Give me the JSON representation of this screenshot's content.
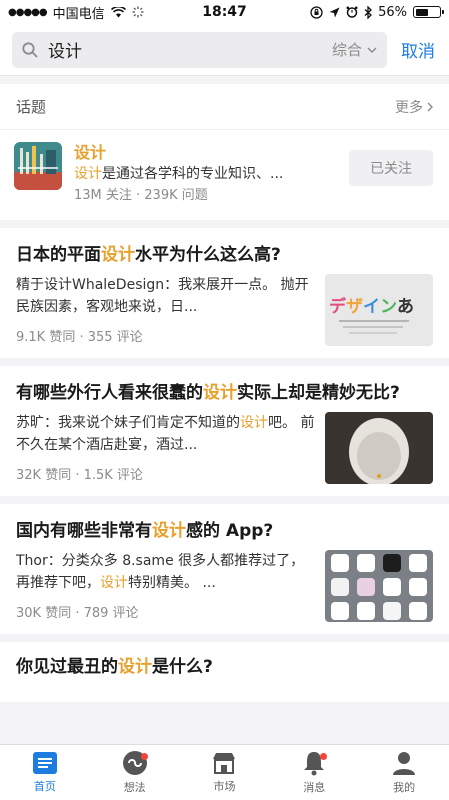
{
  "status": {
    "carrier": "中国电信",
    "time": "18:47",
    "battery": "56%",
    "battery_level": 0.56
  },
  "search": {
    "query": "设计",
    "filter": "综合",
    "cancel": "取消"
  },
  "topics": {
    "header": "话题",
    "more": "更多",
    "item": {
      "name": "设计",
      "desc_hl": "设计",
      "desc_rest": "是通过各学科的专业知识、...",
      "meta": "13M 关注 · 239K 问题",
      "follow": "已关注"
    }
  },
  "questions": [
    {
      "title_pre": "日本的平面",
      "title_hl": "设计",
      "title_post": "水平为什么这么高?",
      "body_pre": "精于设计WhaleDesign：我来展开一点。 抛开民族因素，客观地来说，日...",
      "body_hl": "",
      "body_post": "",
      "meta": "9.1K 赞同 · 355 评论",
      "thumb": "design-art"
    },
    {
      "title_pre": "有哪些外行人看来很蠢的",
      "title_hl": "设计",
      "title_post": "实际上却是精妙无比?",
      "body_pre": "苏旷：我来说个妹子们肯定不知道的",
      "body_hl": "设计",
      "body_post": "吧。 前不久在某个酒店赴宴，酒过...",
      "meta": "32K 赞同 · 1.5K 评论",
      "thumb": "urinal"
    },
    {
      "title_pre": "国内有哪些非常有",
      "title_hl": "设计",
      "title_post": "感的 App?",
      "body_pre": "Thor：分类众多 8.same 很多人都推荐过了，再推荐下吧，",
      "body_hl": "设计",
      "body_post": "特别精美。 ...",
      "meta": "30K 赞同 · 789 评论",
      "thumb": "app-icons"
    }
  ],
  "partial": {
    "title_pre": "你见过最丑的",
    "title_hl": "设计",
    "title_post": "是什么?"
  },
  "tabs": [
    {
      "label": "首页",
      "icon": "home-icon",
      "active": true,
      "dot": false
    },
    {
      "label": "想法",
      "icon": "idea-icon",
      "active": false,
      "dot": true
    },
    {
      "label": "市场",
      "icon": "market-icon",
      "active": false,
      "dot": false
    },
    {
      "label": "消息",
      "icon": "bell-icon",
      "active": false,
      "dot": true
    },
    {
      "label": "我的",
      "icon": "profile-icon",
      "active": false,
      "dot": false
    }
  ],
  "colors": {
    "accent": "#1e7ce0",
    "highlight": "#e8a02c",
    "badge": "#f3453b"
  }
}
